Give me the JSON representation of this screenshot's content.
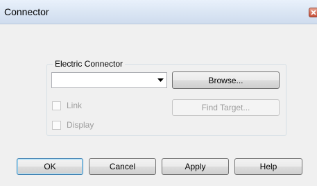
{
  "window": {
    "title": "Connector"
  },
  "group": {
    "legend": "Electric Connector",
    "combo_value": "",
    "browse_label": "Browse...",
    "find_target_label": "Find Target...",
    "link_label": "Link",
    "display_label": "Display"
  },
  "footer": {
    "ok_label": "OK",
    "cancel_label": "Cancel",
    "apply_label": "Apply",
    "help_label": "Help"
  },
  "icons": {
    "close": "close-icon",
    "dropdown": "dropdown-arrow-icon"
  }
}
